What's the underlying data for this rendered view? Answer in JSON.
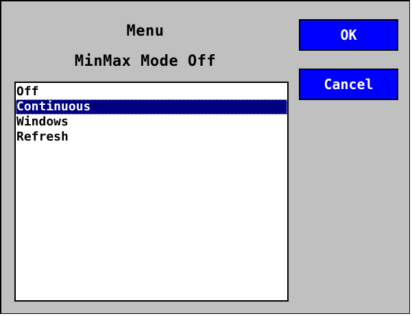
{
  "dialog": {
    "title": "Menu",
    "subtitle": "MinMax Mode Off"
  },
  "list": {
    "items": [
      "Off",
      "Continuous",
      "Windows",
      "Refresh"
    ],
    "selected": "Continuous"
  },
  "buttons": {
    "ok_label": "OK",
    "cancel_label": "Cancel"
  },
  "colors": {
    "dialog_background": "#c0c0c0",
    "button_background": "#0000ff",
    "selection_background": "#000080"
  }
}
